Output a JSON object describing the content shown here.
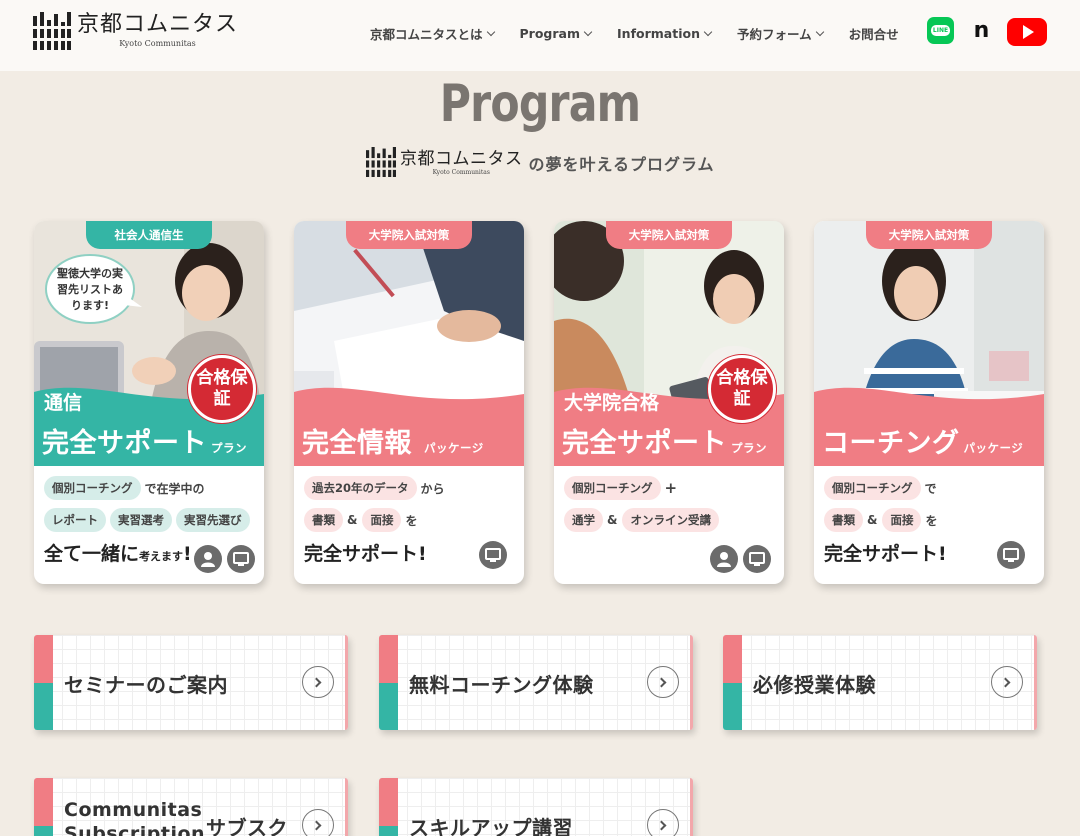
{
  "header": {
    "logo_name": "京都コムニタス",
    "logo_sub": "Kyoto Communitas",
    "nav": [
      {
        "label": "京都コムニタスとは",
        "dropdown": true
      },
      {
        "label": "Program",
        "dropdown": true
      },
      {
        "label": "Information",
        "dropdown": true
      },
      {
        "label": "予約フォーム",
        "dropdown": true
      },
      {
        "label": "お問合せ",
        "dropdown": false
      }
    ],
    "social": {
      "line": "LINE",
      "note": "n",
      "youtube": "youtube-icon"
    }
  },
  "page": {
    "title": "Program",
    "subtitle_logo": "京都コムニタス",
    "subtitle_logo_sub": "Kyoto Communitas",
    "subtitle_text": "の夢を叶えるプログラム"
  },
  "colors": {
    "teal": "#34b5a5",
    "pink": "#f07d84",
    "badge_red": "#d42a34"
  },
  "cards": [
    {
      "tag": "社会人通信生",
      "bubble": "聖徳大学の実習先リストあります!",
      "badge": "合格保証",
      "title_pre": "通信",
      "title": "完全サポート",
      "title_suffix": "プラン",
      "row1_pill": "個別コーチング",
      "row1_text": "で在学中の",
      "row2_pills": [
        "レポート",
        "実習選考",
        "実習先選び"
      ],
      "row3_big": "全て一緒に",
      "row3_small": "考えます",
      "row3_end": "!"
    },
    {
      "tag": "大学院入試対策",
      "title": "完全情報",
      "title_suffix": "パッケージ",
      "row1_pill": "過去20年のデータ",
      "row1_text": "から",
      "row2_pill_a": "書類",
      "row2_amp": "&",
      "row2_pill_b": "面接",
      "row2_text": "を",
      "row3_big": "完全サポート!"
    },
    {
      "tag": "大学院入試対策",
      "badge": "合格保証",
      "title_pre": "大学院合格",
      "title": "完全サポート",
      "title_suffix": "プラン",
      "row1_pill": "個別コーチング",
      "row1_text": "+",
      "row2_pill_a": "通学",
      "row2_amp": "&",
      "row2_pill_b": "オンライン受講"
    },
    {
      "tag": "大学院入試対策",
      "title": "コーチング",
      "title_suffix": "パッケージ",
      "row1_pill": "個別コーチング",
      "row1_text": "で",
      "row2_pill_a": "書類",
      "row2_amp": "&",
      "row2_pill_b": "面接",
      "row2_text": "を",
      "row3_big": "完全サポート!"
    }
  ],
  "links": [
    {
      "label": "セミナーのご案内"
    },
    {
      "label": "無料コーチング体験"
    },
    {
      "label": "必修授業体験"
    },
    {
      "label_line1": "Communitas",
      "label_line2": "Subscription",
      "label_side": "サブスク"
    },
    {
      "label": "スキルアップ講習"
    }
  ]
}
